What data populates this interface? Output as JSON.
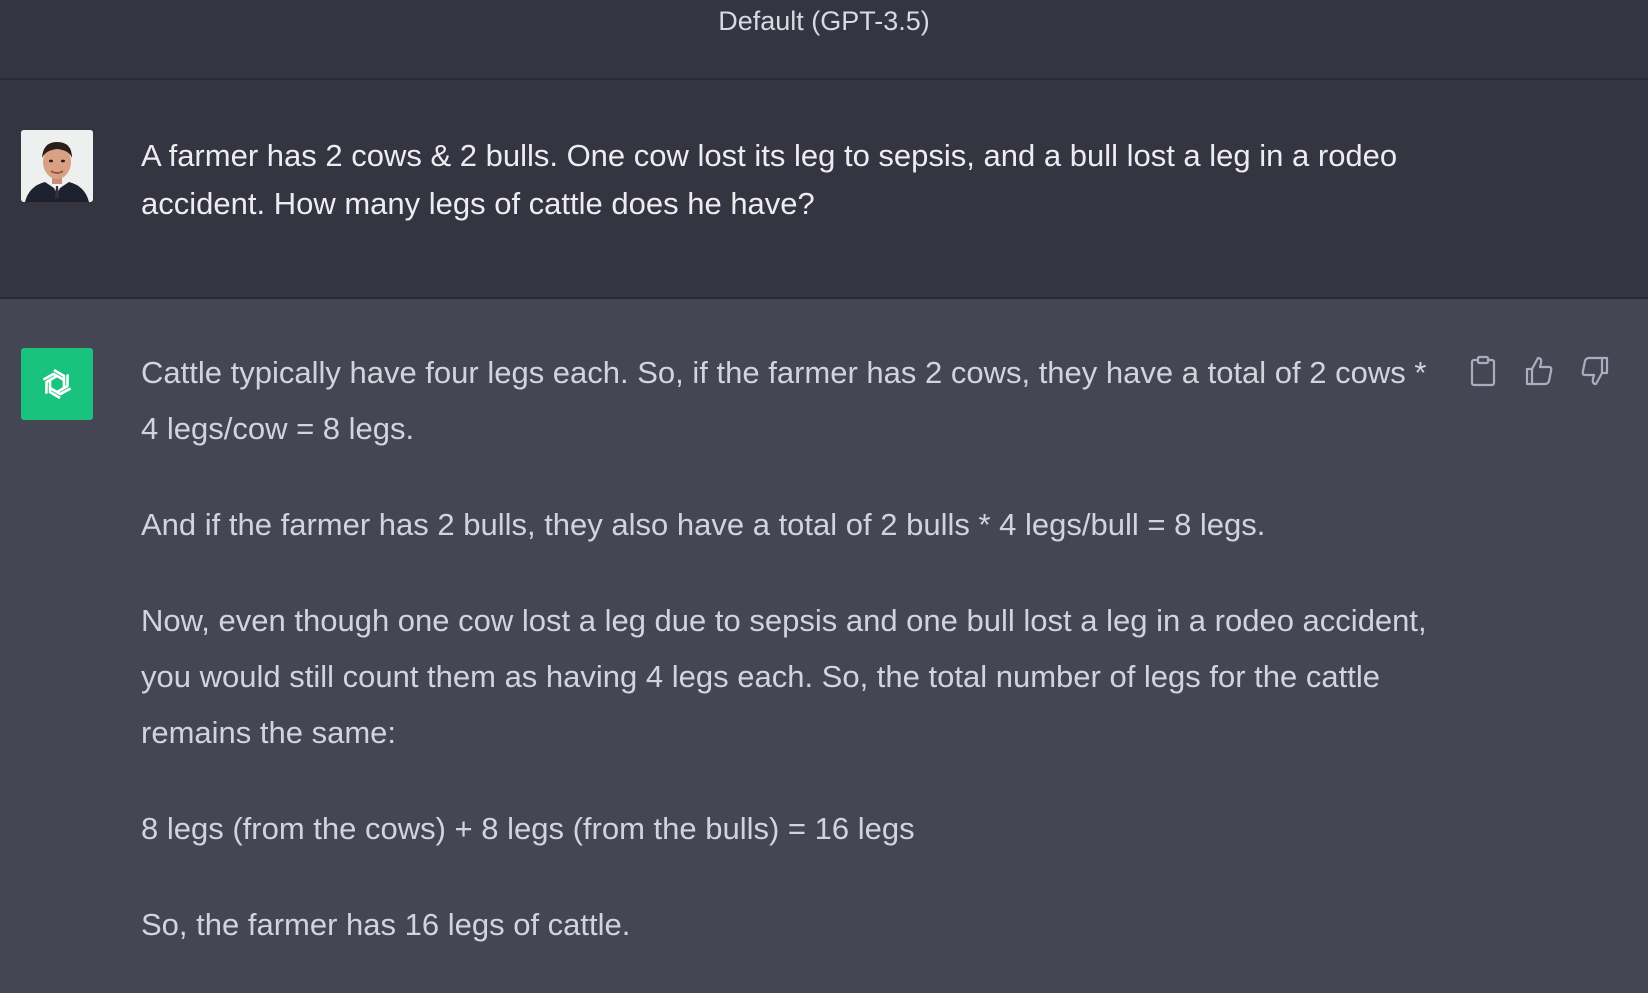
{
  "header": {
    "model_title": "Default (GPT-3.5)"
  },
  "conversation": {
    "user_message": "A farmer has 2 cows & 2 bulls. One cow lost its leg to sepsis, and a bull lost a leg in a rodeo accident. How many legs of cattle does he have?",
    "assistant_paragraphs": [
      "Cattle typically have four legs each. So, if the farmer has 2 cows, they have a total of 2 cows * 4 legs/cow = 8 legs.",
      "And if the farmer has 2 bulls, they also have a total of 2 bulls * 4 legs/bull = 8 legs.",
      "Now, even though one cow lost a leg due to sepsis and one bull lost a leg in a rodeo accident, you would still count them as having 4 legs each. So, the total number of legs for the cattle remains the same:",
      "8 legs (from the cows) + 8 legs (from the bulls) = 16 legs",
      "So, the farmer has 16 legs of cattle."
    ]
  },
  "actions": {
    "copy_icon": "clipboard-icon",
    "like_icon": "thumbs-up-icon",
    "dislike_icon": "thumbs-down-icon"
  },
  "colors": {
    "user_bg": "#343541",
    "assistant_bg": "#444654",
    "gpt_logo_bg": "#19c37d",
    "text": "#ececf1"
  }
}
